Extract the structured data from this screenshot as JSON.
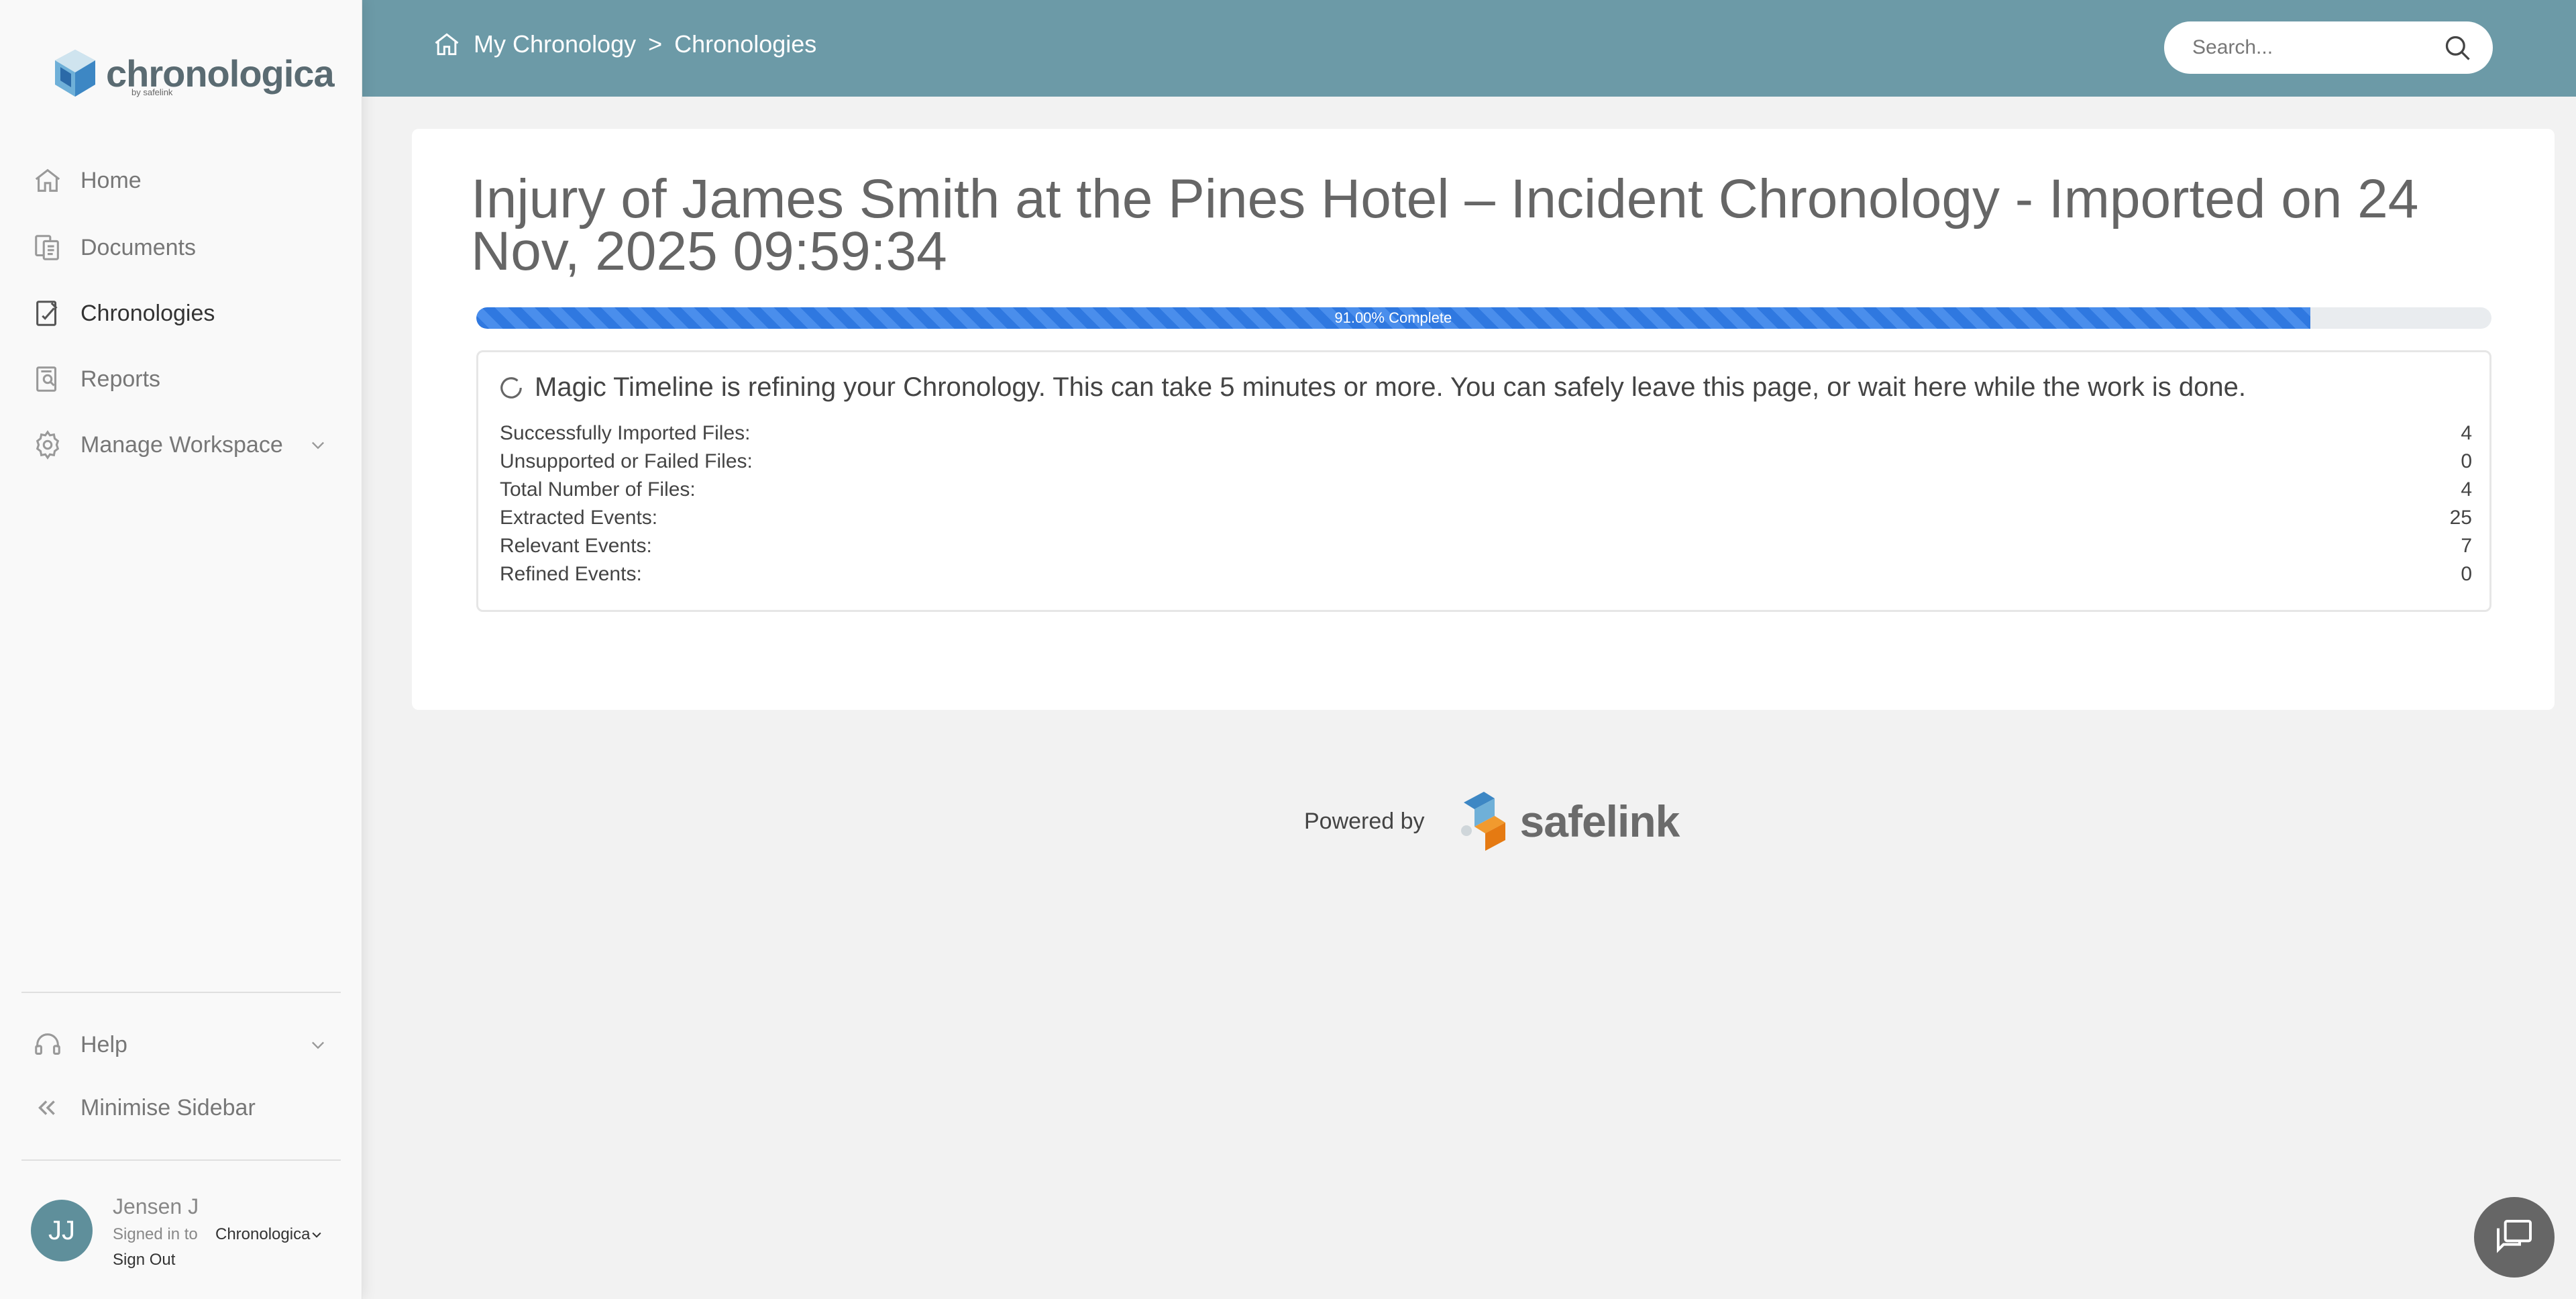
{
  "brand": {
    "name": "chronologica",
    "sub": "by safelink"
  },
  "sidebar": {
    "items": [
      {
        "label": "Home",
        "icon": "home-icon"
      },
      {
        "label": "Documents",
        "icon": "documents-icon"
      },
      {
        "label": "Chronologies",
        "icon": "chronologies-icon",
        "active": true
      },
      {
        "label": "Reports",
        "icon": "reports-icon"
      },
      {
        "label": "Manage Workspace",
        "icon": "gear-icon"
      }
    ],
    "help": "Help",
    "minimise": "Minimise Sidebar"
  },
  "user": {
    "initials": "JJ",
    "name": "Jensen J",
    "signed_in_label": "Signed in to",
    "org": "Chronologica",
    "sign_out": "Sign Out"
  },
  "header": {
    "breadcrumb_root": "My Chronology",
    "breadcrumb_sep": ">",
    "breadcrumb_current": "Chronologies",
    "search_placeholder": "Search..."
  },
  "main": {
    "title": "Injury of James Smith at the Pines Hotel – Incident Chronology - Imported on 24 Nov, 2025 09:59:34",
    "progress": {
      "percent": 91,
      "label": "91.00% Complete"
    },
    "status_message": "Magic Timeline is refining your Chronology. This can take 5 minutes or more. You can safely leave this page, or wait here while the work is done.",
    "stats": [
      {
        "label": "Successfully Imported Files:",
        "value": "4"
      },
      {
        "label": "Unsupported or Failed Files:",
        "value": "0"
      },
      {
        "label": "Total Number of Files:",
        "value": "4"
      },
      {
        "label": "Extracted Events:",
        "value": "25"
      },
      {
        "label": "Relevant Events:",
        "value": "7"
      },
      {
        "label": "Refined Events:",
        "value": "0"
      }
    ]
  },
  "footer": {
    "powered_by": "Powered by",
    "brand": "safelink"
  },
  "colors": {
    "header": "#6c9aa7",
    "progress": "#2f78e0",
    "avatar": "#5f8f9b"
  }
}
